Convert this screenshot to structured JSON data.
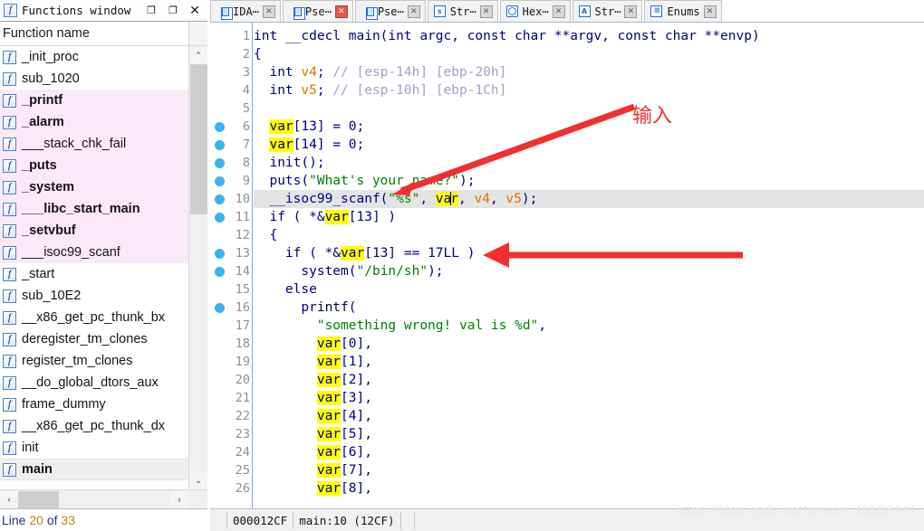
{
  "functions_window": {
    "title": "Functions window",
    "title_icon": "function-icon",
    "window_buttons": {
      "minimize": "❐",
      "restore": "❐",
      "close": "✕"
    },
    "column_header": "Function name",
    "items": [
      {
        "name": "_init_proc",
        "library": false,
        "bold": false,
        "selected": false
      },
      {
        "name": "sub_1020",
        "library": false,
        "bold": false,
        "selected": false
      },
      {
        "name": "_printf",
        "library": true,
        "bold": true,
        "selected": false
      },
      {
        "name": "_alarm",
        "library": true,
        "bold": true,
        "selected": false
      },
      {
        "name": "___stack_chk_fail",
        "library": true,
        "bold": false,
        "selected": false
      },
      {
        "name": "_puts",
        "library": true,
        "bold": true,
        "selected": false
      },
      {
        "name": "_system",
        "library": true,
        "bold": true,
        "selected": false
      },
      {
        "name": "___libc_start_main",
        "library": true,
        "bold": true,
        "selected": false
      },
      {
        "name": "_setvbuf",
        "library": true,
        "bold": true,
        "selected": false
      },
      {
        "name": "___isoc99_scanf",
        "library": true,
        "bold": false,
        "selected": false
      },
      {
        "name": "_start",
        "library": false,
        "bold": false,
        "selected": false
      },
      {
        "name": "sub_10E2",
        "library": false,
        "bold": false,
        "selected": false
      },
      {
        "name": "__x86_get_pc_thunk_bx",
        "library": false,
        "bold": false,
        "selected": false
      },
      {
        "name": "deregister_tm_clones",
        "library": false,
        "bold": false,
        "selected": false
      },
      {
        "name": "register_tm_clones",
        "library": false,
        "bold": false,
        "selected": false
      },
      {
        "name": "__do_global_dtors_aux",
        "library": false,
        "bold": false,
        "selected": false
      },
      {
        "name": "frame_dummy",
        "library": false,
        "bold": false,
        "selected": false
      },
      {
        "name": "__x86_get_pc_thunk_dx",
        "library": false,
        "bold": false,
        "selected": false
      },
      {
        "name": "init",
        "library": false,
        "bold": false,
        "selected": false
      },
      {
        "name": "main",
        "library": false,
        "bold": true,
        "selected": true
      }
    ],
    "scroll_up_arrow": "⌃",
    "scroll_down_arrow": "⌄",
    "scroll_left_arrow": "‹",
    "scroll_right_arrow": "›",
    "status_prefix": "Line ",
    "status_line": "20",
    "status_middle": " of ",
    "status_total": "33"
  },
  "tabs": [
    {
      "label": "IDA⋯",
      "icon": "document-icon",
      "close": "✕",
      "close_style": "gray",
      "active": true
    },
    {
      "label": "Pse⋯",
      "icon": "document-icon",
      "close": "✕",
      "close_style": "red",
      "active": false
    },
    {
      "label": "Pse⋯",
      "icon": "document-icon",
      "close": "✕",
      "close_style": "gray",
      "active": false
    },
    {
      "label": "Str⋯",
      "icon": "strings-icon",
      "close": "✕",
      "close_style": "gray",
      "active": false
    },
    {
      "label": "Hex⋯",
      "icon": "hexview-icon",
      "close": "✕",
      "close_style": "gray",
      "active": false
    },
    {
      "label": "Str⋯",
      "icon": "structures-icon",
      "close": "✕",
      "close_style": "gray",
      "active": false
    },
    {
      "label": "Enums",
      "icon": "enums-icon",
      "close": "✕",
      "close_style": "gray",
      "active": false
    }
  ],
  "code": {
    "line_numbers": [
      "1",
      "2",
      "3",
      "4",
      "5",
      "6",
      "7",
      "8",
      "9",
      "10",
      "11",
      "12",
      "13",
      "14",
      "15",
      "16",
      "17",
      "18",
      "19",
      "20",
      "21",
      "22",
      "23",
      "24",
      "25",
      "26"
    ],
    "breakpoint_lines": [
      6,
      7,
      8,
      9,
      10,
      11,
      13,
      14,
      16
    ],
    "current_line": 10,
    "lines": [
      "int __cdecl main(int argc, const char **argv, const char **envp)",
      "{",
      "  int v4; // [esp-14h] [ebp-20h]",
      "  int v5; // [esp-10h] [ebp-1Ch]",
      "",
      "  var[13] = 0;",
      "  var[14] = 0;",
      "  init();",
      "  puts(\"What's your name?\");",
      "  __isoc99_scanf(\"%s\", var, v4, v5);",
      "  if ( *&var[13] )",
      "  {",
      "    if ( *&var[13] == 17LL )",
      "      system(\"/bin/sh\");",
      "    else",
      "      printf(",
      "        \"something wrong! val is %d\",",
      "        var[0],",
      "        var[1],",
      "        var[2],",
      "        var[3],",
      "        var[4],",
      "        var[5],",
      "        var[6],",
      "        var[7],",
      "        var[8],"
    ]
  },
  "code_status": {
    "address": "000012CF",
    "location": "main:10  (12CF)"
  },
  "annotations": [
    {
      "text": "输入",
      "kind": "callout-label",
      "color": "#f03030"
    }
  ],
  "watermark": "https://blog.csdn.net/weixin_45556441",
  "colors": {
    "library_row": "#fce9f7",
    "selected_row": "#efefef",
    "highlight_var": "#ffff00",
    "current_line": "#e4e4e4",
    "breakpoint": "#38b3ef",
    "keyword": "#00007f",
    "string": "#008000",
    "comment": "#a0a0c8",
    "local_var": "#e07000",
    "annotation_red": "#f03030"
  }
}
